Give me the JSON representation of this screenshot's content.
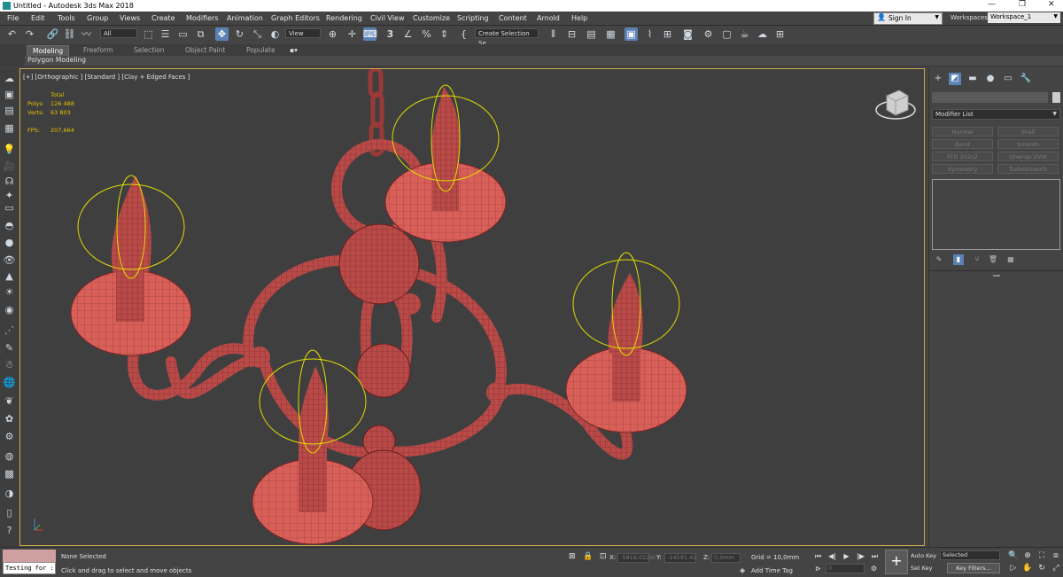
{
  "window": {
    "title": "Untitled - Autodesk 3ds Max 2018",
    "controls": [
      "—",
      "❐",
      "✕"
    ]
  },
  "menu": {
    "items": [
      "File",
      "Edit",
      "Tools",
      "Group",
      "Views",
      "Create",
      "Modifiers",
      "Animation",
      "Graph Editors",
      "Rendering",
      "Civil View",
      "Customize",
      "Scripting",
      "Content",
      "Arnold",
      "Help"
    ],
    "sign_in": "Sign In",
    "workspaces_label": "Workspaces:",
    "workspace": "Workspace_1"
  },
  "toolbar": {
    "filter": "All",
    "ref_coord": "View",
    "selection_set": "Create Selection Se",
    "angle": "3",
    "percent": "%"
  },
  "ribbon": {
    "tabs": [
      "Modeling",
      "Freeform",
      "Selection",
      "Object Paint",
      "Populate"
    ],
    "sub": "Polygon Modeling"
  },
  "viewport": {
    "label": "[+] [Orthographic ] [Standard ] [Clay + Edged Faces ]",
    "stats": {
      "total_label": "Total",
      "polys_label": "Polys:",
      "polys": "126 488",
      "verts_label": "Verts:",
      "verts": "63 803",
      "fps_label": "FPS:",
      "fps": "207,664"
    }
  },
  "command_panel": {
    "modifier_list": "Modifier List",
    "modifiers": [
      "Normal",
      "Shell",
      "Bend",
      "Smooth",
      "FFD 2x2x2",
      "Unwrap UVW",
      "Symmetry",
      "TurboSmooth"
    ]
  },
  "status": {
    "maxscript": "Testing for :",
    "selection": "None Selected",
    "prompt": "Click and drag to select and move objects",
    "x_label": "X:",
    "x": "-5819,022m",
    "y_label": "Y:",
    "y": "-14591,42",
    "z_label": "Z:",
    "z": "0,0mm",
    "grid": "Grid = 10,0mm",
    "add_time_tag": "Add Time Tag",
    "frame": "0",
    "auto_key": "Auto Key",
    "set_key": "Set Key",
    "key_mode": "Selected",
    "key_filters": "Key Filters..."
  },
  "colors": {
    "accent": "#5b82b5",
    "model": "#b84a48",
    "gizmo": "#e0dc00",
    "viewport_border": "#c9a94a"
  }
}
